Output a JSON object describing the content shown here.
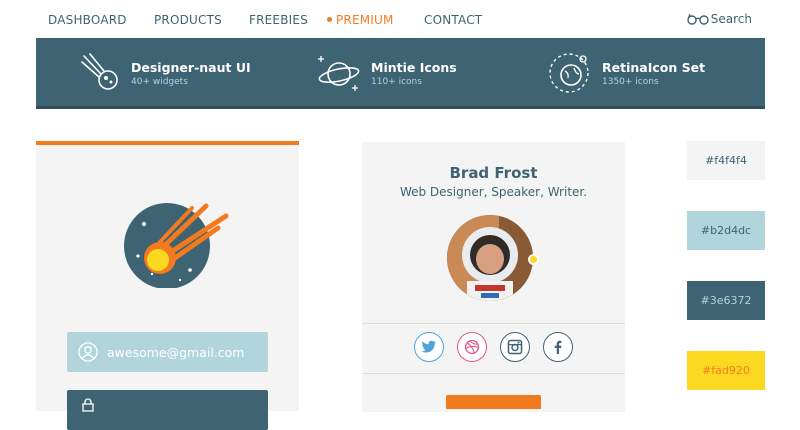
{
  "nav": {
    "items": [
      "DASHBOARD",
      "PRODUCTS",
      "FREEBIES",
      "PREMIUM",
      "CONTACT"
    ],
    "active": "PREMIUM",
    "search_label": "Search"
  },
  "banner": {
    "items": [
      {
        "title": "Designer-naut UI",
        "subtitle": "40+ widgets",
        "icon": "comet-icon"
      },
      {
        "title": "Mintie Icons",
        "subtitle": "110+ icons",
        "icon": "planet-icon"
      },
      {
        "title": "RetinaIcon Set",
        "subtitle": "1350+ icons",
        "icon": "globe-orbit-icon"
      }
    ]
  },
  "login": {
    "email_value": "awesome@gmail.com"
  },
  "profile": {
    "name": "Brad Frost",
    "role": "Web Designer, Speaker, Writer.",
    "social": [
      "twitter-icon",
      "dribbble-icon",
      "instagram-icon",
      "facebook-icon"
    ]
  },
  "palette": {
    "swatches": [
      {
        "label": "#f4f4f4",
        "color": "#f4f4f4"
      },
      {
        "label": "#b2d4dc",
        "color": "#b2d4dc"
      },
      {
        "label": "#3e6372",
        "color": "#3e6372"
      },
      {
        "label": "#fad920",
        "color": "#fad920"
      }
    ]
  },
  "colors": {
    "accent": "#f47a20",
    "primary": "#3e6372",
    "light": "#f4f4f4",
    "sky": "#b2d4dc",
    "yellow": "#fad920"
  }
}
